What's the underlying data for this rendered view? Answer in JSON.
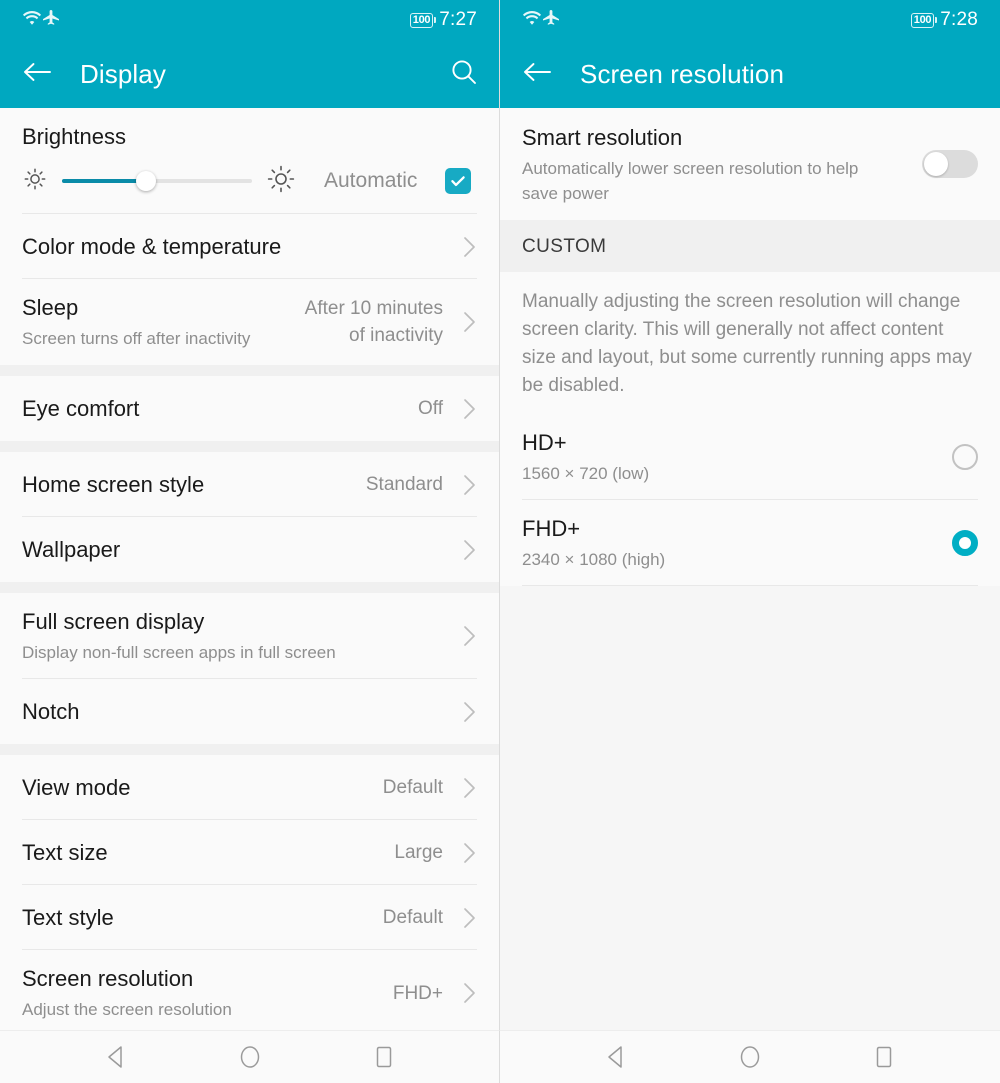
{
  "theme": {
    "accent": "#00a8c0",
    "slider_fill": "#0a8ba8",
    "checkbox": "#17aac4",
    "radio_on": "#00aec4"
  },
  "left_panel": {
    "status_bar": {
      "wifi_icon": "wifi-icon",
      "airplane_icon": "airplane-mode-icon",
      "battery_text": "100",
      "time": "7:27"
    },
    "app_bar": {
      "back_icon": "back-arrow-icon",
      "title": "Display",
      "search_icon": "search-icon"
    },
    "brightness": {
      "title": "Brightness",
      "low_icon": "brightness-low-icon",
      "high_icon": "brightness-high-icon",
      "slider_percent": 44,
      "auto_label": "Automatic",
      "auto_checked": true
    },
    "rows": [
      {
        "title": "Color mode & temperature",
        "sub": "",
        "value": "",
        "chevron": true
      },
      {
        "title": "Sleep",
        "sub": "Screen turns off after inactivity",
        "value": "After 10 minutes of inactivity",
        "chevron": true
      },
      {
        "title": "Eye comfort",
        "sub": "",
        "value": "Off",
        "chevron": true
      },
      {
        "title": "Home screen style",
        "sub": "",
        "value": "Standard",
        "chevron": true
      },
      {
        "title": "Wallpaper",
        "sub": "",
        "value": "",
        "chevron": true
      },
      {
        "title": "Full screen display",
        "sub": "Display non-full screen apps in full screen",
        "value": "",
        "chevron": true
      },
      {
        "title": "Notch",
        "sub": "",
        "value": "",
        "chevron": true
      },
      {
        "title": "View mode",
        "sub": "",
        "value": "Default",
        "chevron": true
      },
      {
        "title": "Text size",
        "sub": "",
        "value": "Large",
        "chevron": true
      },
      {
        "title": "Text style",
        "sub": "",
        "value": "Default",
        "chevron": true
      },
      {
        "title": "Screen resolution",
        "sub": "Adjust the screen resolution",
        "value": "FHD+",
        "chevron": true
      }
    ]
  },
  "right_panel": {
    "status_bar": {
      "wifi_icon": "wifi-icon",
      "airplane_icon": "airplane-mode-icon",
      "battery_text": "100",
      "time": "7:28"
    },
    "app_bar": {
      "back_icon": "back-arrow-icon",
      "title": "Screen resolution"
    },
    "smart_resolution": {
      "title": "Smart resolution",
      "sub": "Automatically lower screen resolution to help save power",
      "toggle_on": false
    },
    "custom_header": "CUSTOM",
    "custom_description": "Manually adjusting the screen resolution will change screen clarity. This will generally not affect content size and layout, but some currently running apps may be disabled.",
    "options": [
      {
        "title": "HD+",
        "sub": "1560 × 720 (low)",
        "selected": false
      },
      {
        "title": "FHD+",
        "sub": "2340 × 1080 (high)",
        "selected": true
      }
    ]
  },
  "nav_bar": {
    "back_icon": "nav-back-triangle-icon",
    "home_icon": "nav-home-circle-icon",
    "recents_icon": "nav-recents-square-icon"
  }
}
